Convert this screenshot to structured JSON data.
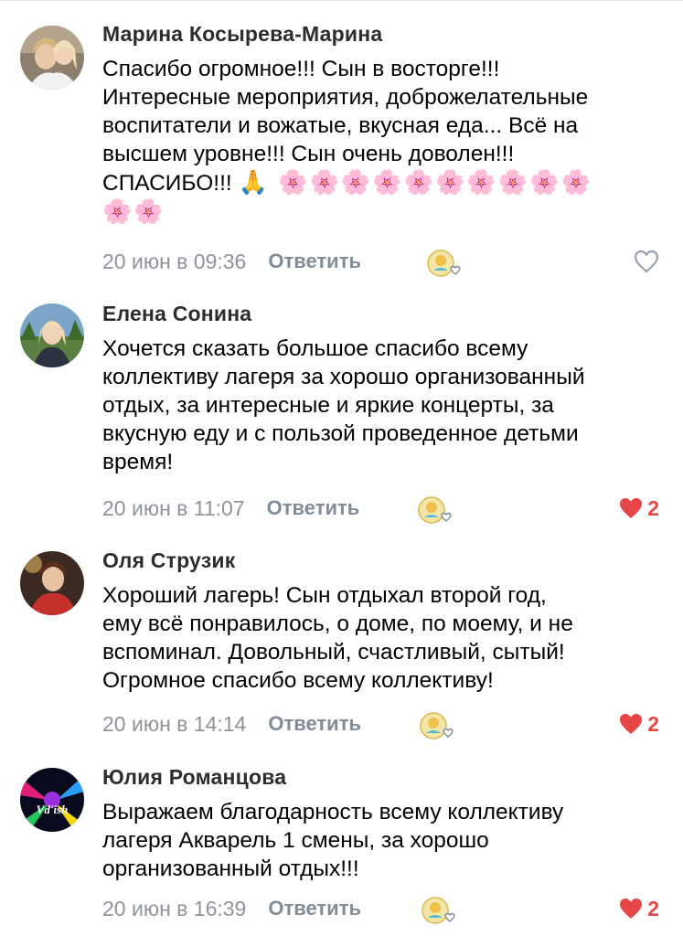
{
  "comments": [
    {
      "author": "Марина Косырева-Марина",
      "text": "Спасибо огромное!!! Сын в восторге!!!\nИнтересные мероприятия, доброжелательные\nвоспитатели и вожатые,  вкусная еда... Всё на\nвысшем уровне!!! Сын очень доволен!!!\nСПАСИБО!!! ",
      "emoji_line1": "🙏 🌸🌸🌸🌸🌸🌸🌸🌸🌸🌸",
      "emoji_line2": "🌸🌸",
      "date": "20 июн в 09:36",
      "reply": "Ответить",
      "likes": "",
      "liked": false
    },
    {
      "author": "Елена Сонина",
      "text": "Хочется сказать большое спасибо всему\nколлективу лагеря за хорошо организованный\nотдых, за интересные и яркие концерты, за\nвкусную еду и с пользой проведенное детьми\nвремя!",
      "date": "20 июн в 11:07",
      "reply": "Ответить",
      "likes": "2",
      "liked": true
    },
    {
      "author": "Оля Струзик",
      "text": "Хороший лагерь! Сын отдыхал второй год,\nему всё понравилось, о доме, по моему, и не\nвспоминал. Довольный, счастливый, сытый!\nОгромное спасибо всему коллективу!",
      "date": "20 июн в 14:14",
      "reply": "Ответить",
      "likes": "2",
      "liked": true
    },
    {
      "author": "Юлия Романцова",
      "text": "Выражаем благодарность всему коллективу\nлагеря Акварель 1 смены, за хорошо\nорганизованный отдых!!!",
      "avatar_text": "Vd'ish",
      "date": "20 июн в 16:39",
      "reply": "Ответить",
      "likes": "2",
      "liked": true
    }
  ],
  "icons": {
    "like_empty": "heart-outline-icon",
    "like_filled": "heart-filled-icon",
    "sticker": "reaction-sticker-icon"
  },
  "colors": {
    "like_red": "#e64646",
    "secondary_text": "#818c99",
    "author_text": "#2c2d2e"
  }
}
